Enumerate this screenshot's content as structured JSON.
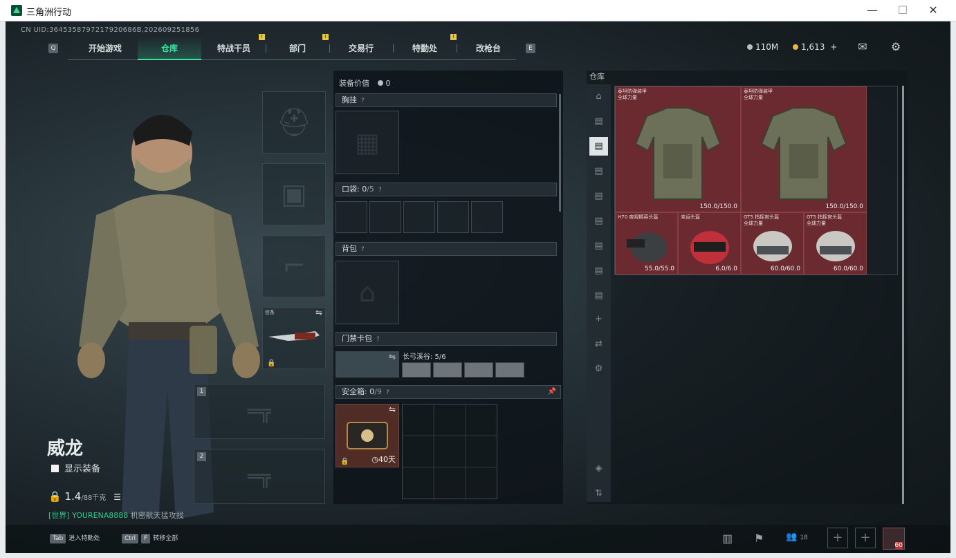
{
  "window": {
    "title": "三角洲行动",
    "minimize": "—",
    "maximize": "☐",
    "close": "✕"
  },
  "header": {
    "uid": "CN UID:3645358797217920686B,202609251856",
    "left_key": "Q",
    "right_key": "E",
    "tabs": [
      "开始游戏",
      "仓库",
      "特战干员",
      "部门",
      "交易行",
      "特勤处",
      "改枪台"
    ],
    "active_tab": "仓库",
    "currency_1": "110M",
    "currency_2": "1,613",
    "plus": "+",
    "colors": {
      "accent": "#39e6a0",
      "alert": "#e8c53a"
    }
  },
  "character": {
    "name": "威龙",
    "show_gear_label": "显示装备",
    "weight": "1.4",
    "weight_max": "/88千克",
    "chat_channel": "[世界]",
    "chat_user": "YOURENA8888",
    "chat_text": "机密航天猛攻找",
    "melee_label": "信条"
  },
  "equipment": {
    "value_label": "装备价值",
    "value": "0",
    "chest_label": "胸挂",
    "pocket_label": "口袋:",
    "pocket_count": "0",
    "pocket_max": "/5",
    "backpack_label": "背包",
    "keycard_label": "门禁卡包",
    "keycard_sub": "长弓溪谷: 5/6",
    "safe_label": "安全箱:",
    "safe_count": "0",
    "safe_max": "/9",
    "safe_timer": "40天",
    "q": "?"
  },
  "warehouse": {
    "title": "仓库",
    "items": [
      {
        "name": "泰坦防弹装甲\n全球力量",
        "durability": "150.0/150.0"
      },
      {
        "name": "泰坦防弹装甲\n全球力量",
        "durability": "150.0/150.0"
      },
      {
        "name": "H70 夜视精英头盔",
        "durability": "55.0/55.0"
      },
      {
        "name": "幸运头盔",
        "durability": "6.0/6.0"
      },
      {
        "name": "GT5 指挥官头盔\n全球力量",
        "durability": "60.0/60.0"
      },
      {
        "name": "GT5 指挥官头盔\n全球力量",
        "durability": "60.0/60.0"
      }
    ],
    "sidebar_add": "+"
  },
  "bottom": {
    "tab_key": "Tab",
    "tab_label": "进入特勤处",
    "ctrl_key": "Ctrl",
    "f_key": "F",
    "ctrl_label": "转移全部",
    "squad_count": "18",
    "level": "60"
  }
}
